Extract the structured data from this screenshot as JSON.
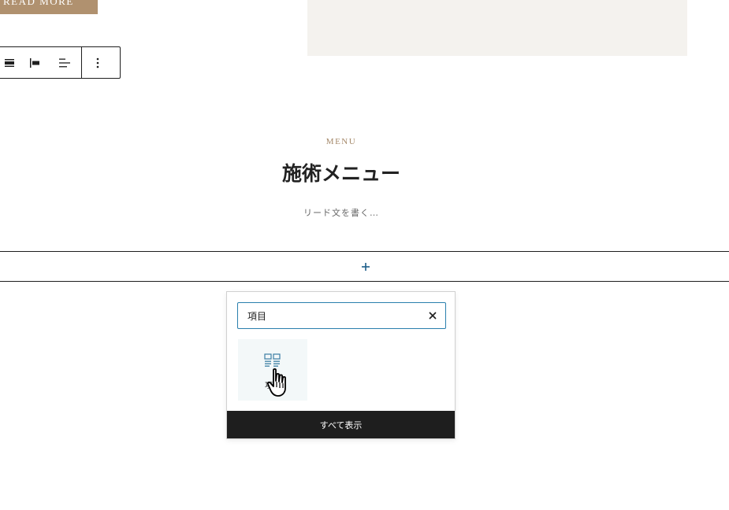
{
  "read_more": {
    "label": "READ MORE"
  },
  "section": {
    "label": "MENU",
    "heading": "施術メニュー",
    "lead": "リード文を書く…"
  },
  "inserter": {
    "search_value": "項目",
    "result_label": "項目",
    "browse_all_label": "すべて表示"
  },
  "icons": {
    "toolbar": [
      "align-full-icon",
      "align-left-icon",
      "justify-left-icon",
      "more-vertical-icon"
    ],
    "appender": "plus-icon",
    "clear": "close-icon",
    "block": "media-text-grid-icon"
  },
  "colors": {
    "accent": "#2a7fad",
    "brand": "#b0916f",
    "dark": "#1e1e1e"
  }
}
